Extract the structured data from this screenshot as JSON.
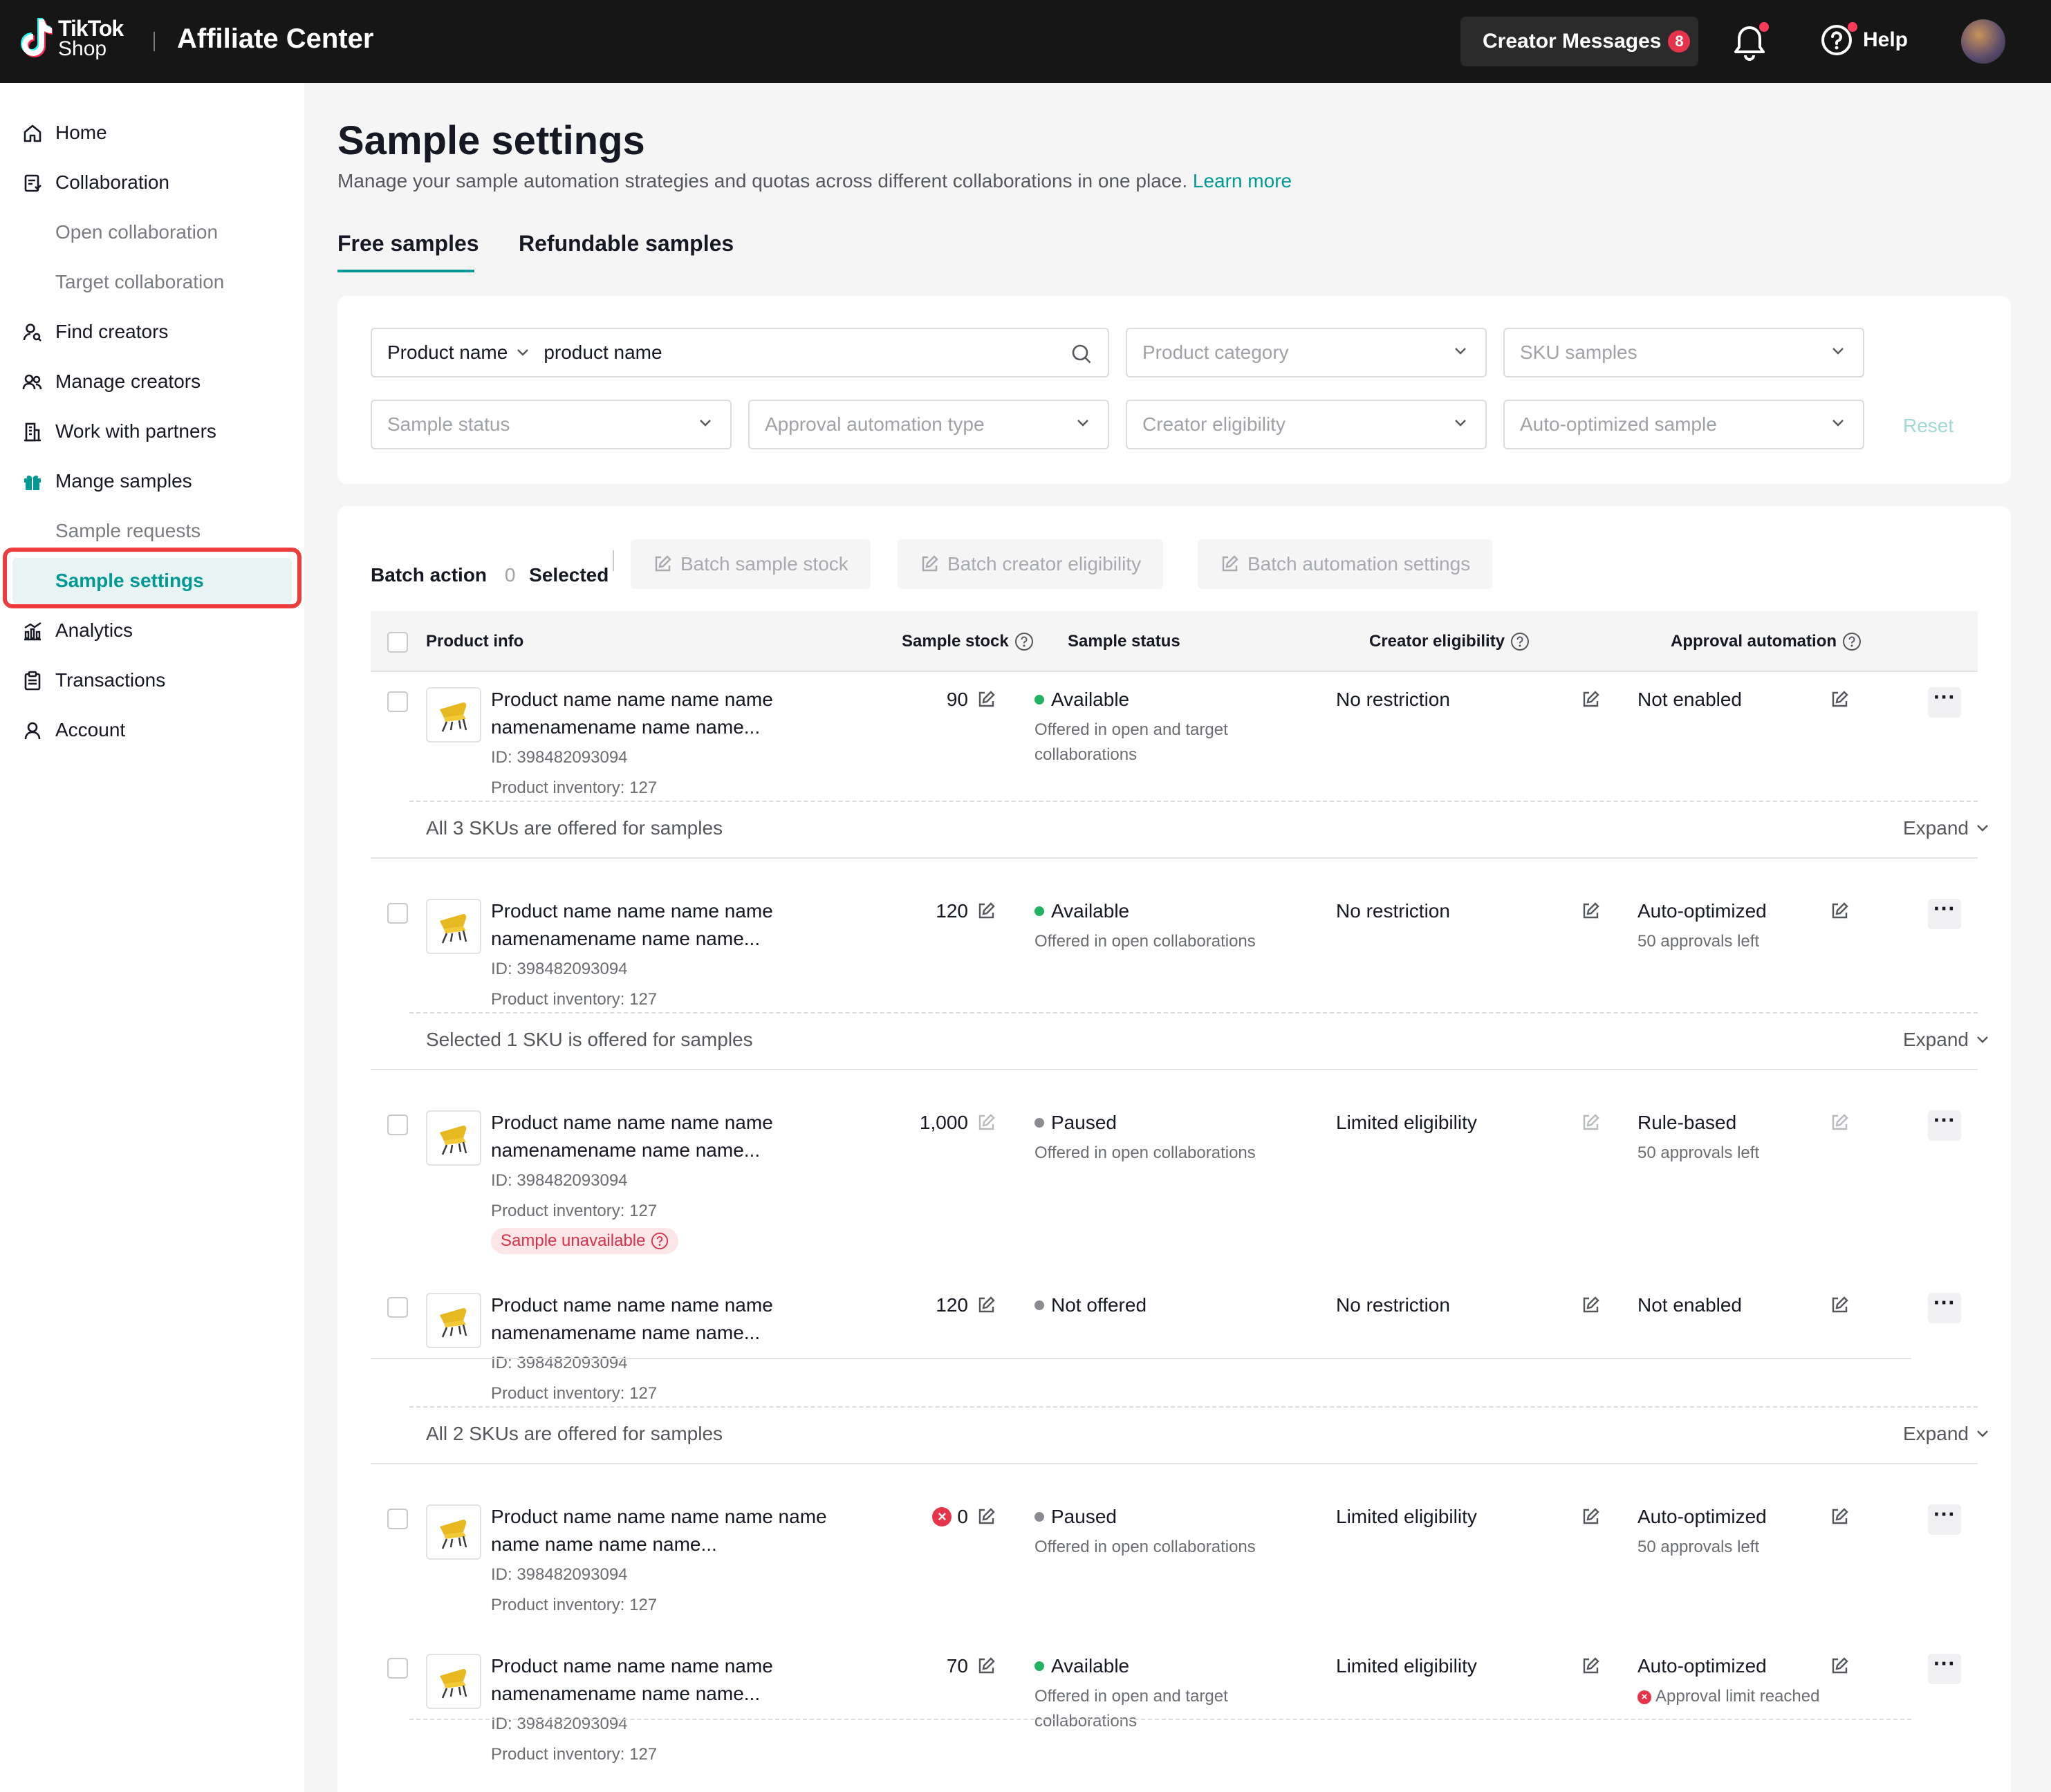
{
  "header": {
    "logo_line1": "TikTok",
    "logo_line2": "Shop",
    "app_title": "Affiliate Center",
    "messages_label": "Creator Messages",
    "messages_count": "8",
    "help_label": "Help"
  },
  "sidebar": {
    "items": [
      {
        "label": "Home",
        "icon": "home-icon"
      },
      {
        "label": "Collaboration",
        "icon": "collaboration-icon"
      },
      {
        "label": "Open collaboration"
      },
      {
        "label": "Target collaboration"
      },
      {
        "label": "Find creators",
        "icon": "find-creators-icon"
      },
      {
        "label": "Manage creators",
        "icon": "manage-creators-icon"
      },
      {
        "label": "Work with partners",
        "icon": "partners-icon"
      },
      {
        "label": "Mange samples",
        "icon": "gift-icon"
      },
      {
        "label": "Sample requests"
      },
      {
        "label": "Sample settings",
        "active": true
      },
      {
        "label": "Analytics",
        "icon": "analytics-icon"
      },
      {
        "label": "Transactions",
        "icon": "transactions-icon"
      },
      {
        "label": "Account",
        "icon": "account-icon"
      }
    ]
  },
  "page": {
    "title": "Sample settings",
    "description": "Manage your sample automation strategies and quotas across different collaborations in one place.",
    "learn_more": "Learn more",
    "tabs": [
      "Free samples",
      "Refundable samples"
    ]
  },
  "filters": {
    "search_type": "Product name",
    "search_value": "product name",
    "product_category": "Product category",
    "sku_samples": "SKU samples",
    "sample_status": "Sample status",
    "approval_automation_type": "Approval automation type",
    "creator_eligibility": "Creator eligibility",
    "auto_optimized_sample": "Auto-optimized sample",
    "reset": "Reset"
  },
  "batch": {
    "label": "Batch action",
    "selected_count": "0",
    "selected_label": "Selected",
    "sample_stock": "Batch sample stock",
    "creator_eligibility": "Batch creator eligibility",
    "automation_settings": "Batch automation settings"
  },
  "table": {
    "headers": {
      "product_info": "Product info",
      "sample_stock": "Sample stock",
      "sample_status": "Sample status",
      "creator_eligibility": "Creator eligibility",
      "approval_automation": "Approval automation"
    },
    "rows": [
      {
        "name1": "Product name name name name",
        "name2": "namenamename name name...",
        "id": "ID: 398482093094",
        "inventory": "Product inventory: 127",
        "stock": "90",
        "status": "Available",
        "status_color": "#21b360",
        "status_sub1": "Offered in open and target",
        "status_sub2": "collaborations",
        "eligibility": "No restriction",
        "automation": "Not enabled",
        "automation_sub": ""
      },
      {
        "name1": "Product name name name name",
        "name2": "namenamename name name...",
        "id": "ID: 398482093094",
        "inventory": "Product inventory: 127",
        "stock": "120",
        "status": "Available",
        "status_color": "#21b360",
        "status_sub1": "Offered in open collaborations",
        "status_sub2": "",
        "eligibility": "No restriction",
        "automation": "Auto-optimized",
        "automation_sub": "50 approvals left"
      },
      {
        "name1": "Product name name name name",
        "name2": "namenamename name name...",
        "id": "ID: 398482093094",
        "inventory": "Product inventory: 127",
        "stock": "1,000",
        "status": "Paused",
        "status_color": "#8a8b91",
        "status_sub1": "Offered in open collaborations",
        "status_sub2": "",
        "eligibility": "Limited eligibility",
        "automation": "Rule-based",
        "automation_sub": "50 approvals left",
        "tag": "Sample unavailable"
      },
      {
        "name1": "Product name name name name",
        "name2": "namenamename name name...",
        "id": "ID: 398482093094",
        "inventory": "Product inventory: 127",
        "stock": "120",
        "status": "Not offered",
        "status_color": "#8a8b91",
        "status_sub1": "",
        "status_sub2": "",
        "eligibility": "No restriction",
        "automation": "Not enabled",
        "automation_sub": ""
      },
      {
        "name1": "Product name name name name name",
        "name2": "name name name name...",
        "id": "ID: 398482093094",
        "inventory": "Product inventory: 127",
        "stock": "0",
        "status": "Paused",
        "status_color": "#8a8b91",
        "status_sub1": "Offered in open collaborations",
        "status_sub2": "",
        "eligibility": "Limited eligibility",
        "automation": "Auto-optimized",
        "automation_sub": "50 approvals left"
      },
      {
        "name1": "Product name name name name",
        "name2": "namenamename name name...",
        "id": "ID: 398482093094",
        "inventory": "Product inventory: 127",
        "stock": "70",
        "status": "Available",
        "status_color": "#21b360",
        "status_sub1": "Offered in open and target",
        "status_sub2": "collaborations",
        "eligibility": "Limited eligibility",
        "automation": "Auto-optimized",
        "automation_sub": "Approval limit reached"
      }
    ],
    "sku_rows": [
      {
        "text": "All 3 SKUs are offered for samples",
        "expand": "Expand"
      },
      {
        "text": "Selected 1 SKU is offered for samples",
        "expand": "Expand"
      },
      {
        "text": "All 2 SKUs are offered for samples",
        "expand": "Expand"
      }
    ]
  }
}
